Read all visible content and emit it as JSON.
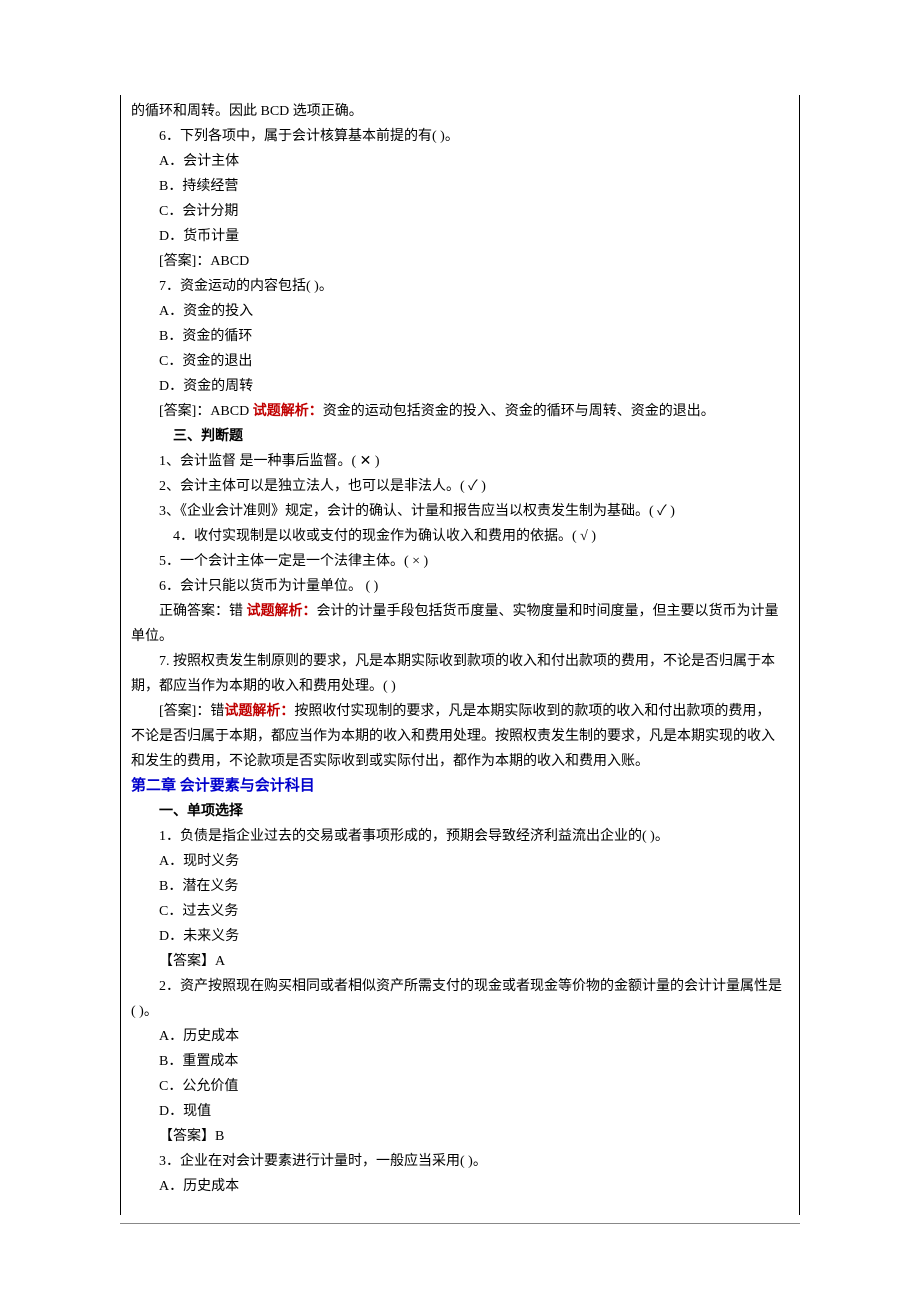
{
  "intro": "的循环和周转。因此 BCD 选项正确。",
  "q6": {
    "stem": "6．下列各项中，属于会计核算基本前提的有(    )。",
    "a": "A．会计主体",
    "b": "B．持续经营",
    "c": "C．会计分期",
    "d": "D．货币计量",
    "ans": "[答案]：ABCD"
  },
  "q7": {
    "stem": "7．资金运动的内容包括(    )。",
    "a": "A．资金的投入",
    "b": "B．资金的循环",
    "c": "C．资金的退出",
    "d": "D．资金的周转",
    "ans_prefix": "[答案]：ABCD ",
    "ans_red": "试题解析：",
    "ans_rest": "资金的运动包括资金的投入、资金的循环与周转、资金的退出。"
  },
  "sec3_title": "三、判断题",
  "j1": "1、会计监督  是一种事后监督。(     ✕    )",
  "j2": "2、会计主体可以是独立法人，也可以是非法人。(     ✓    )",
  "j3": "3、《企业会计准则》规定，会计的确认、计量和报告应当以权责发生制为基础。(     ✓    )",
  "j4": "4．收付实现制是以收或支付的现金作为确认收入和费用的依据。(    √    )",
  "j5": "5．一个会计主体一定是一个法律主体。(    ×    )",
  "j6": "6．会计只能以货币为计量单位。 (    )",
  "j6ans_prefix": "正确答案：错    ",
  "j6ans_red": "试题解析：",
  "j6ans_rest": "会计的计量手段包括货币度量、实物度量和时间度量，但主要以货币为计量单位。",
  "j7_l1": "7. 按照权责发生制原则的要求，凡是本期实际收到款项的收入和付出款项的费用，不论是否归属于本",
  "j7_l2": "期，都应当作为本期的收入和费用处理。(    )",
  "j7ans_prefix": "[答案]：错",
  "j7ans_red": "试题解析：",
  "j7ans_l1_rest": "按照收付实现制的要求，凡是本期实际收到的款项的收入和付出款项的费用，",
  "j7ans_l2": "不论是否归属于本期，都应当作为本期的收入和费用处理。按照权责发生制的要求，凡是本期实现的收入",
  "j7ans_l3": "和发生的费用，不论款项是否实际收到或实际付出，都作为本期的收入和费用入账。",
  "ch2_title": "第二章  会计要素与会计科目",
  "ch2_sec1": "一、单项选择",
  "c2q1": {
    "stem": "1．负债是指企业过去的交易或者事项形成的，预期会导致经济利益流出企业的(    )。",
    "a": "A．现时义务",
    "b": "B．潜在义务",
    "c": "C．过去义务",
    "d": "D．未来义务",
    "ans": "【答案】A"
  },
  "c2q2": {
    "stem_l1": "2．资产按照现在购买相同或者相似资产所需支付的现金或者现金等价物的金额计量的会计计量属性是",
    "stem_l2": "(    )。",
    "a": "A．历史成本",
    "b": "B．重置成本",
    "c": "C．公允价值",
    "d": "D．现值",
    "ans": "【答案】B"
  },
  "c2q3": {
    "stem": "3．企业在对会计要素进行计量时，一般应当采用(    )。",
    "a": "A．历史成本"
  }
}
